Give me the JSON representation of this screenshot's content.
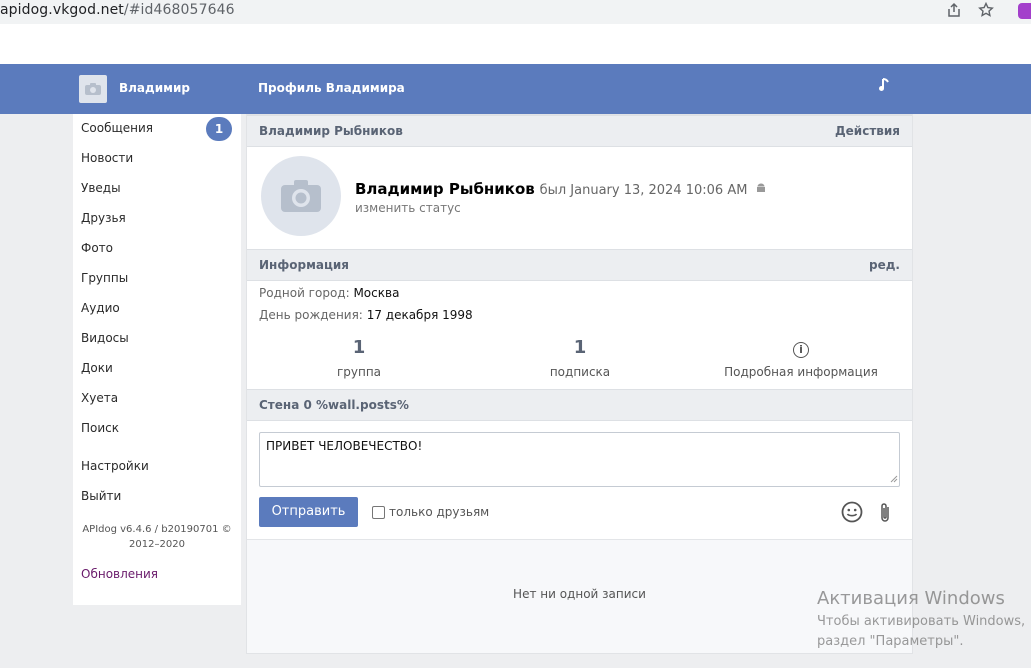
{
  "browser": {
    "url_host": "apidog.vkgod.net",
    "url_path": "/#id468057646"
  },
  "header": {
    "user_name": "Владимир",
    "page_title": "Профиль Владимира",
    "music_icon": "music-note-icon"
  },
  "sidebar": {
    "items": [
      {
        "label": "Сообщения",
        "badge": "1"
      },
      {
        "label": "Новости"
      },
      {
        "label": "Уведы"
      },
      {
        "label": "Друзья"
      },
      {
        "label": "Фото"
      },
      {
        "label": "Группы"
      },
      {
        "label": "Аудио"
      },
      {
        "label": "Видосы"
      },
      {
        "label": "Доки"
      },
      {
        "label": "Хуета"
      },
      {
        "label": "Поиск"
      },
      {
        "label": "Настройки"
      },
      {
        "label": "Выйти"
      }
    ],
    "version_line1": "APIdog v6.4.6 / b20190701 ©",
    "version_line2": "2012–2020",
    "updates_label": "Обновления"
  },
  "profile": {
    "section_title": "Владимир Рыбников",
    "actions_label": "Действия",
    "full_name": "Владимир Рыбников",
    "last_seen": "был January 13, 2024 10:06 AM",
    "device_icon": "android-icon",
    "status_placeholder": "изменить статус"
  },
  "info": {
    "section_title": "Информация",
    "edit_label": "ред.",
    "hometown_key": "Родной город:",
    "hometown_value": "Москва",
    "birthday_key": "День рождения:",
    "birthday_value": "17 декабря 1998",
    "counters": [
      {
        "value": "1",
        "label": "группа"
      },
      {
        "value": "1",
        "label": "подписка"
      },
      {
        "label": "Подробная информация"
      }
    ]
  },
  "wall": {
    "section_title": "Стена 0 %wall.posts%",
    "post_text": "ПРИВЕТ ЧЕЛОВЕЧЕСТВО!",
    "send_label": "Отправить",
    "friends_only_label": "только друзьям",
    "friends_only_checked": false,
    "empty_text": "Нет ни одной записи"
  },
  "watermark": {
    "title": "Активация Windows",
    "line1": "Чтобы активировать Windows,",
    "line2": "раздел \"Параметры\"."
  },
  "colors": {
    "accent": "#5b7bbd",
    "page_bg": "#edeef0",
    "section_bg": "#eceef1",
    "updates_link": "#6a1b6b"
  }
}
